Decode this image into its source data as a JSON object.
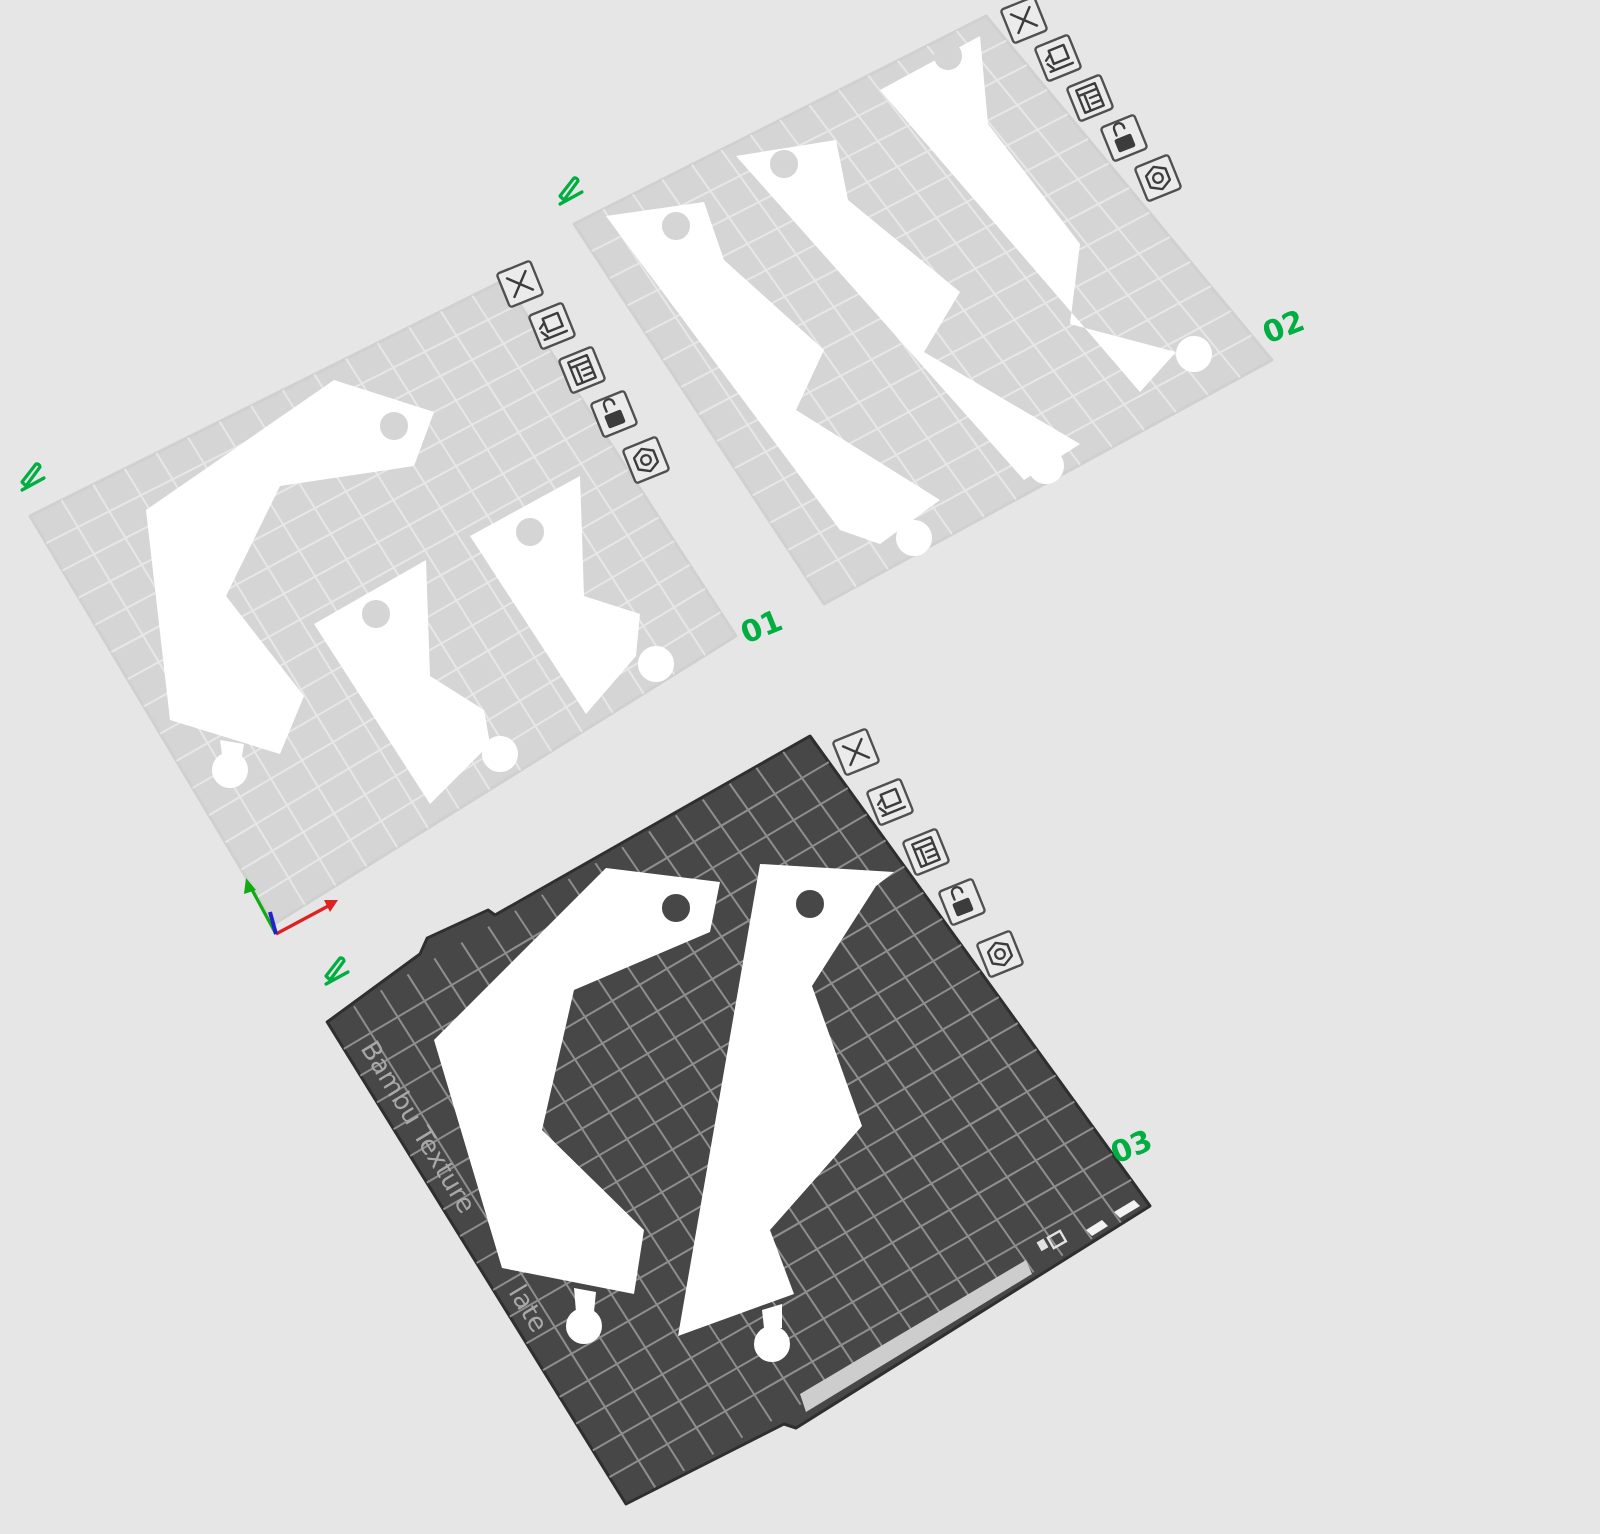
{
  "plates": [
    {
      "label": "01",
      "selected": false,
      "locked": false
    },
    {
      "label": "02",
      "selected": false,
      "locked": false
    },
    {
      "label": "03",
      "selected": true,
      "locked": false,
      "bed_texts": [
        "Bambu Texture",
        "late"
      ]
    }
  ]
}
